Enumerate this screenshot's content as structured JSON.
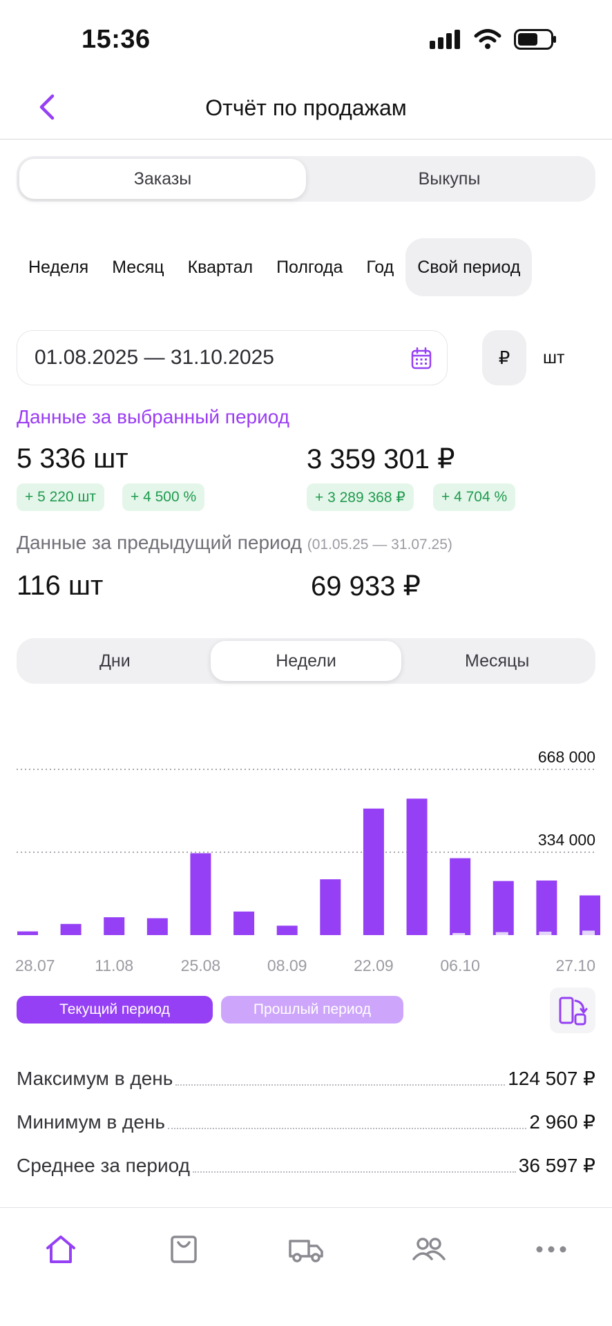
{
  "status_bar": {
    "time": "15:36"
  },
  "header": {
    "title": "Отчёт по продажам"
  },
  "top_segment": {
    "options": [
      "Заказы",
      "Выкупы"
    ],
    "selected": "Заказы"
  },
  "period_tabs": {
    "items": [
      "Неделя",
      "Месяц",
      "Квартал",
      "Полгода",
      "Год",
      "Свой период"
    ],
    "selected": "Свой период"
  },
  "date_range": {
    "value": "01.08.2025 — 31.10.2025"
  },
  "units": {
    "rub": "₽",
    "pcs": "шт",
    "selected": "₽"
  },
  "current_period": {
    "title": "Данные за выбранный период",
    "qty": "5 336 шт",
    "sum": "3 359 301 ₽",
    "qty_delta": "+ 5 220 шт",
    "qty_delta_pct": "+ 4 500 %",
    "sum_delta": "+ 3 289 368 ₽",
    "sum_delta_pct": "+ 4 704 %"
  },
  "previous_period": {
    "title": "Данные за предыдущий период",
    "range": "(01.05.25 — 31.07.25)",
    "qty": "116 шт",
    "sum": "69 933 ₽"
  },
  "granularity": {
    "options": [
      "Дни",
      "Недели",
      "Месяцы"
    ],
    "selected": "Недели"
  },
  "chart_data": {
    "type": "bar",
    "x_tick_labels": [
      "28.07",
      "11.08",
      "25.08",
      "08.09",
      "22.09",
      "06.10",
      "27.10"
    ],
    "y_tick_labels": [
      "668 000",
      "334 000"
    ],
    "y_ticks": [
      668000,
      334000
    ],
    "ylim": [
      0,
      668000
    ],
    "grid": true,
    "categories": [
      "28.07",
      "04.08",
      "11.08",
      "18.08",
      "25.08",
      "01.09",
      "08.09",
      "15.09",
      "22.09",
      "29.09",
      "06.10",
      "13.10",
      "20.10",
      "27.10"
    ],
    "series": [
      {
        "name": "Текущий период",
        "values": [
          15000,
          45000,
          72000,
          68000,
          330000,
          95000,
          38000,
          225000,
          510000,
          550000,
          310000,
          218000,
          220000,
          160000
        ],
        "color": "#9540f4"
      },
      {
        "name": "Прошлый период",
        "values": [
          0,
          0,
          0,
          0,
          0,
          0,
          0,
          0,
          0,
          0,
          8000,
          12000,
          14000,
          18000
        ],
        "color": "#e4d6fb"
      }
    ]
  },
  "legend": {
    "current": "Текущий период",
    "previous": "Прошлый период"
  },
  "stats": [
    {
      "label": "Максимум в день",
      "value": "124 507 ₽"
    },
    {
      "label": "Минимум в день",
      "value": "2 960 ₽"
    },
    {
      "label": "Среднее за период",
      "value": "36 597 ₽"
    }
  ],
  "tab_bar": {
    "icons": [
      "home-icon",
      "shopping-bag-icon",
      "truck-icon",
      "users-icon",
      "more-icon"
    ],
    "active": "home-icon"
  },
  "colors": {
    "accent": "#9540f4",
    "accent_light": "#cda6fb",
    "positive": "#1f9a4e",
    "positive_bg": "#e4f6ea"
  }
}
